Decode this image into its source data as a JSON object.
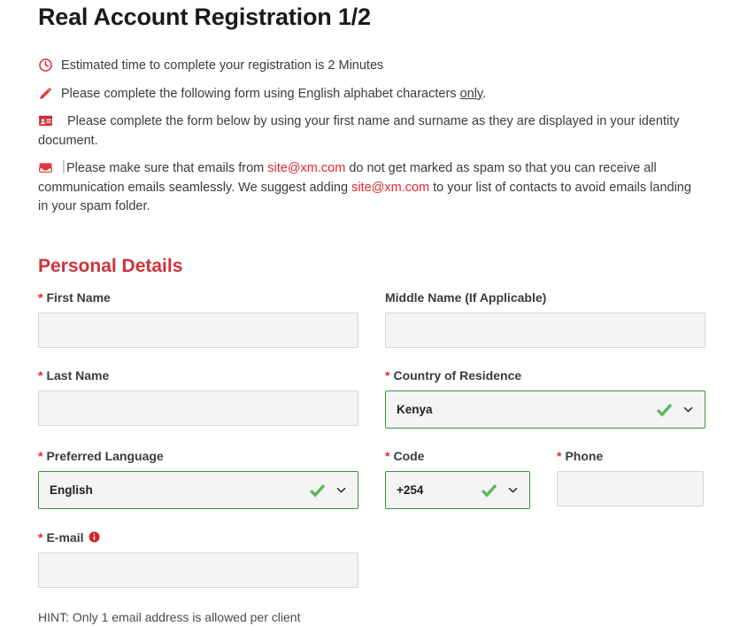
{
  "page": {
    "title": "Real Account Registration 1/2"
  },
  "notices": [
    {
      "icon": "clock-icon",
      "text": "Estimated time to complete your registration is 2 Minutes"
    },
    {
      "icon": "pencil-icon",
      "text_before": "Please complete the following form using English alphabet characters ",
      "emphasis": "only",
      "text_after": "."
    },
    {
      "icon": "id-card-icon",
      "text": "Please complete the form below by using your first name and surname as they are displayed in your identity document."
    },
    {
      "icon": "envelope-icon",
      "part1": "Please make sure that emails from ",
      "link1": "site@xm.com",
      "part2": " do not get marked as spam so that you can receive all communication emails seamlessly. We suggest adding ",
      "link2": "site@xm.com",
      "part3": " to your list of contacts to avoid emails landing in your spam folder."
    }
  ],
  "personal_details": {
    "heading": "Personal Details",
    "fields": {
      "first_name": {
        "label": "First Name",
        "required_mark": "*",
        "value": "",
        "placeholder": ""
      },
      "middle_name": {
        "label": "Middle Name (If Applicable)",
        "required_mark": "",
        "value": "",
        "placeholder": ""
      },
      "last_name": {
        "label": "Last Name",
        "required_mark": "*",
        "value": "",
        "placeholder": ""
      },
      "country": {
        "label": "Country of Residence",
        "required_mark": "*",
        "value": "Kenya",
        "state": "valid"
      },
      "language": {
        "label": "Preferred Language",
        "required_mark": "*",
        "value": "English",
        "state": "valid"
      },
      "code": {
        "label": "Code",
        "required_mark": "*",
        "value": "+254",
        "state": "valid"
      },
      "phone": {
        "label": "Phone",
        "required_mark": "*",
        "value": "",
        "placeholder": ""
      },
      "email": {
        "label": "E-mail",
        "required_mark": "*",
        "value": "",
        "placeholder": "",
        "info_icon": "info-icon"
      }
    },
    "hint": "HINT: Only 1 email address is allowed per client"
  },
  "colors": {
    "accent_red": "#e1272c",
    "heading_red": "#cf3339",
    "valid_green": "#3c9140",
    "check_green": "#5cb85c",
    "input_bg": "#f4f4f4",
    "input_border": "#d6d6d6",
    "text": "#3b3b3b",
    "caret_blue": "#b8ccdc"
  }
}
